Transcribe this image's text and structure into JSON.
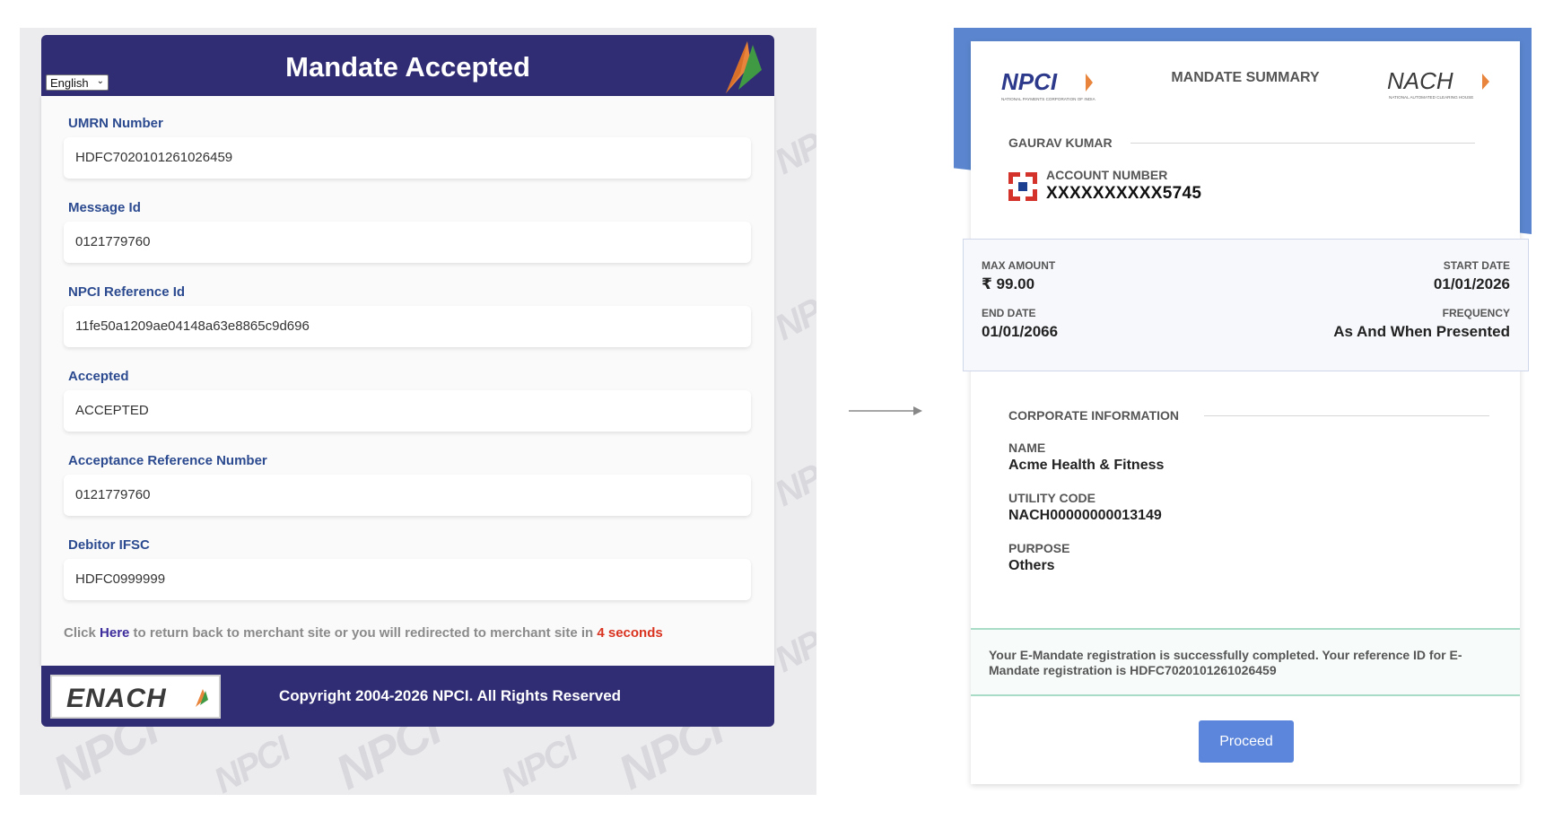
{
  "left": {
    "header": {
      "title": "Mandate Accepted",
      "language": "English"
    },
    "fields": [
      {
        "label": "UMRN Number",
        "value": "HDFC7020101261026459"
      },
      {
        "label": "Message Id",
        "value": "0121779760"
      },
      {
        "label": "NPCI Reference Id",
        "value": "11fe50a1209ae04148a63e8865c9d696"
      },
      {
        "label": "Accepted",
        "value": "ACCEPTED"
      },
      {
        "label": "Acceptance Reference Number",
        "value": "0121779760"
      },
      {
        "label": "Debitor IFSC",
        "value": "HDFC0999999"
      }
    ],
    "redirect": {
      "prefix": "Click ",
      "link": "Here",
      "middle": " to return back to merchant site or you will redirected to merchant site in ",
      "seconds": "4 seconds"
    },
    "footer": {
      "logo_text": "ENACH",
      "copyright": "Copyright 2004-2026 NPCI. All Rights Reserved"
    },
    "watermark_text": "NPCI"
  },
  "right": {
    "logos": {
      "npci": "NPCI",
      "npci_sub": "NATIONAL PAYMENTS CORPORATION OF INDIA",
      "nach": "NACH",
      "nach_sub": "NATIONAL AUTOMATED CLEARING HOUSE"
    },
    "title": "MANDATE SUMMARY",
    "holder_name": "GAURAV KUMAR",
    "account_label": "ACCOUNT NUMBER",
    "account_value": "XXXXXXXXXX5745",
    "max_amount_label": "MAX AMOUNT",
    "max_amount_value": "₹ 99.00",
    "start_date_label": "START DATE",
    "start_date_value": "01/01/2026",
    "end_date_label": "END DATE",
    "end_date_value": "01/01/2066",
    "frequency_label": "FREQUENCY",
    "frequency_value": "As And When Presented",
    "corporate_title": "CORPORATE INFORMATION",
    "name_label": "NAME",
    "name_value": "Acme Health & Fitness",
    "utility_label": "UTILITY CODE",
    "utility_value": "NACH00000000013149",
    "purpose_label": "PURPOSE",
    "purpose_value": "Others",
    "success_prefix": "Your E-Mandate registration is successfully completed. Your reference ID for E-Mandate registration is ",
    "success_ref": "HDFC7020101261026459",
    "proceed_label": "Proceed"
  },
  "colors": {
    "header_navy": "#302d74",
    "label_blue": "#2b4a8f",
    "link_purple": "#3c2c9c",
    "seconds_red": "#d9321f",
    "accent_blue": "#5b86db",
    "success_border": "#a9dcc6"
  },
  "icons": [
    "chevron-down-icon",
    "flag-logo-icon",
    "bank-logo-icon",
    "arrow-right-icon"
  ]
}
